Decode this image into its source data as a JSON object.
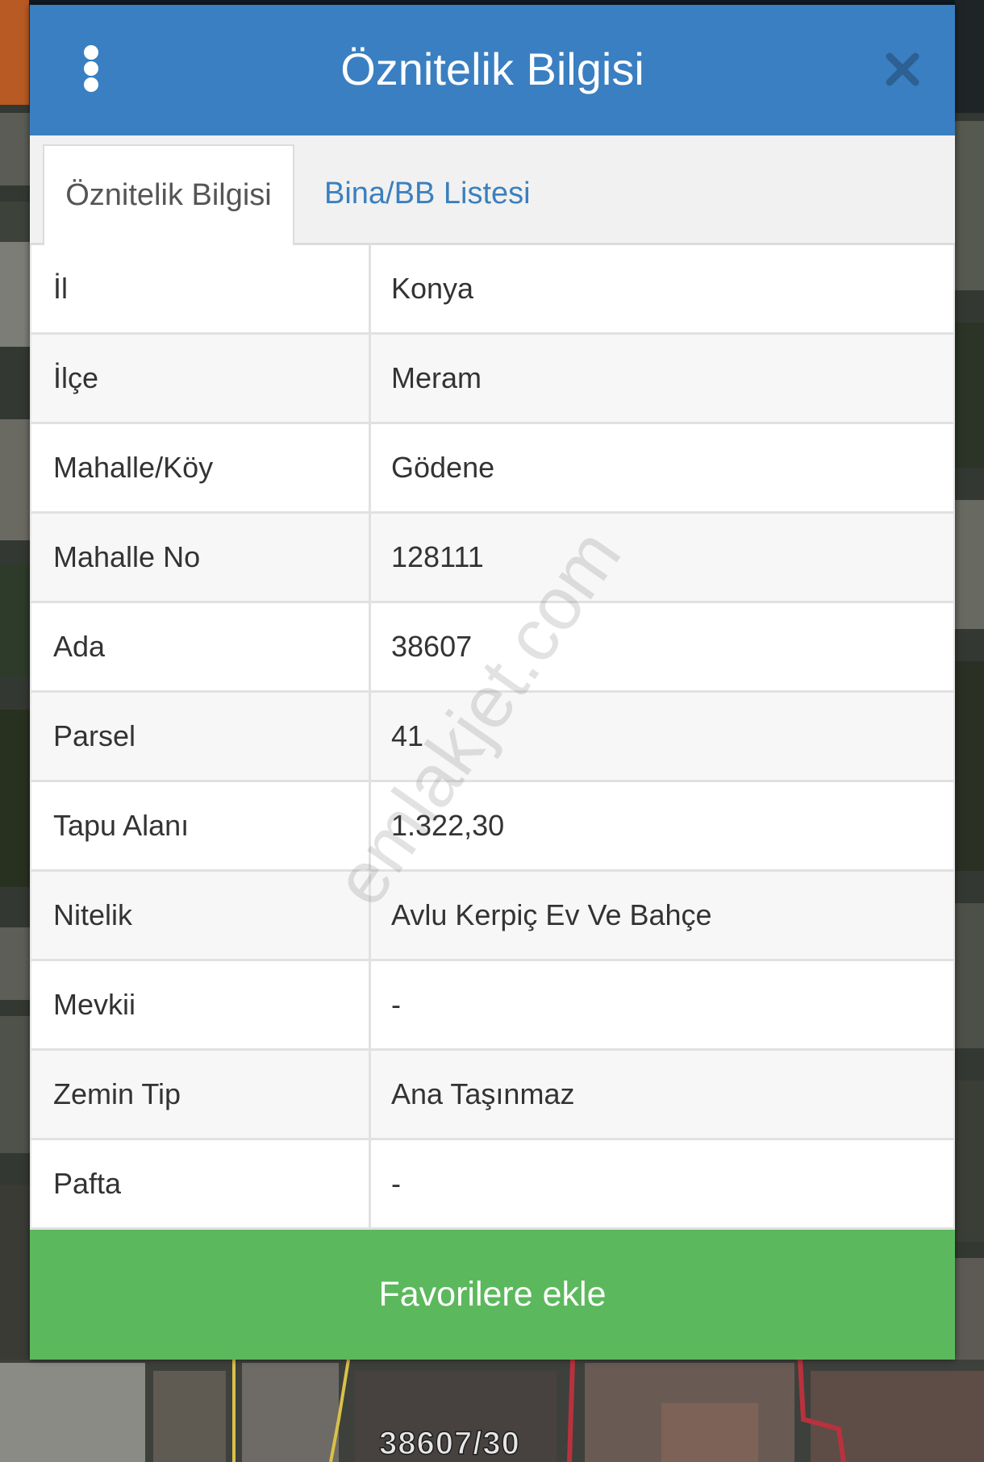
{
  "dialog": {
    "title": "Öznitelik Bilgisi",
    "menu_icon": "more-vertical-icon",
    "close_icon": "close-icon"
  },
  "tabs": [
    {
      "label": "Öznitelik Bilgisi",
      "active": true
    },
    {
      "label": "Bina/BB Listesi",
      "active": false
    }
  ],
  "attributes": [
    {
      "label": "İl",
      "value": "Konya"
    },
    {
      "label": "İlçe",
      "value": "Meram"
    },
    {
      "label": "Mahalle/Köy",
      "value": "Gödene"
    },
    {
      "label": "Mahalle No",
      "value": "128111"
    },
    {
      "label": "Ada",
      "value": "38607"
    },
    {
      "label": "Parsel",
      "value": "41"
    },
    {
      "label": "Tapu Alanı",
      "value": "1.322,30"
    },
    {
      "label": "Nitelik",
      "value": "Avlu Kerpiç Ev Ve Bahçe"
    },
    {
      "label": "Mevkii",
      "value": "-"
    },
    {
      "label": "Zemin Tip",
      "value": "Ana Taşınmaz"
    },
    {
      "label": "Pafta",
      "value": "-"
    }
  ],
  "favorite_button": {
    "label": "Favorilere ekle"
  },
  "watermark": {
    "text": "emlakjet.com"
  },
  "map": {
    "parcel_label": "38607/30"
  },
  "colors": {
    "header": "#3a7fc1",
    "tab_link": "#3b80bd",
    "button": "#5cb85c",
    "parcel_line": "#b8323e",
    "road_line": "#d9c14a"
  }
}
